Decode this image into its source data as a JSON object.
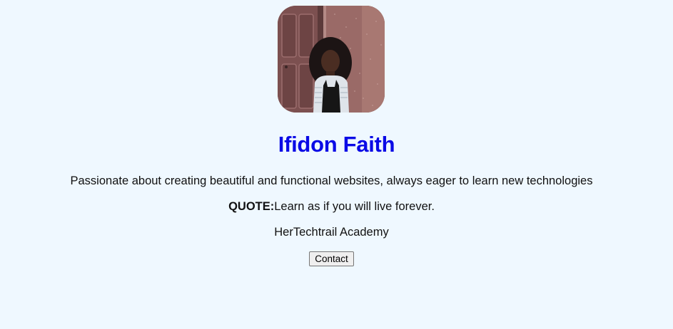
{
  "profile": {
    "photo_alt": "Profile photo",
    "name": "Ifidon Faith",
    "bio": "Passionate about creating beautiful and functional websites, always eager to learn new technologies",
    "quote_label": "QUOTE:",
    "quote_text": "Learn as if you will live forever.",
    "organization": "HerTechtrail Academy",
    "contact_label": "Contact"
  },
  "colors": {
    "background": "#eff8ff",
    "name_accent": "#0a0ae6"
  }
}
